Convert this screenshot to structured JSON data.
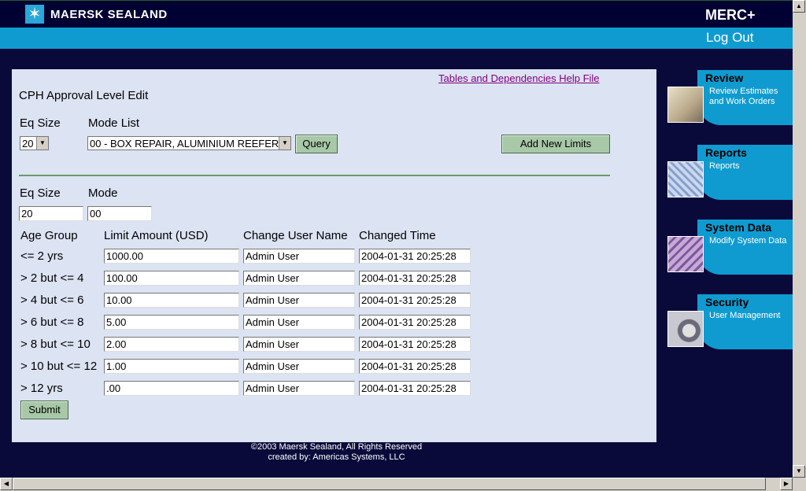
{
  "header": {
    "brand": "MAERSK SEALAND",
    "app": "MERC+",
    "logout": "Log Out"
  },
  "panel": {
    "help_link": "Tables and Dependencies Help File",
    "title": "CPH Approval Level Edit",
    "eq_size_label": "Eq Size",
    "mode_list_label": "Mode List",
    "eq_size_value": "20",
    "mode_list_value": "00 - BOX REPAIR, ALUMINIUM REEFER",
    "query_button": "Query",
    "add_button": "Add New Limits",
    "eq_size_label2": "Eq Size",
    "mode_label": "Mode",
    "eq_size_field": "20",
    "mode_field": "00",
    "columns": [
      "Age Group",
      "Limit Amount (USD)",
      "Change User Name",
      "Changed Time"
    ],
    "rows": [
      {
        "age": "<= 2 yrs",
        "limit": "1000.00",
        "user": "Admin User",
        "time": "2004-01-31 20:25:28"
      },
      {
        "age": "> 2 but <= 4",
        "limit": "100.00",
        "user": "Admin User",
        "time": "2004-01-31 20:25:28"
      },
      {
        "age": "> 4 but <= 6",
        "limit": "10.00",
        "user": "Admin User",
        "time": "2004-01-31 20:25:28"
      },
      {
        "age": "> 6 but <= 8",
        "limit": "5.00",
        "user": "Admin User",
        "time": "2004-01-31 20:25:28"
      },
      {
        "age": "> 8 but <= 10",
        "limit": "2.00",
        "user": "Admin User",
        "time": "2004-01-31 20:25:28"
      },
      {
        "age": "> 10 but <= 12",
        "limit": "1.00",
        "user": "Admin User",
        "time": "2004-01-31 20:25:28"
      },
      {
        "age": "> 12 yrs",
        "limit": ".00",
        "user": "Admin User",
        "time": "2004-01-31 20:25:28"
      }
    ],
    "submit": "Submit"
  },
  "footer": {
    "line1": "©2003 Maersk Sealand, All Rights Reserved",
    "line2": "created by: Americas Systems, LLC"
  },
  "sidenav": [
    {
      "heading": "Review",
      "links": [
        "Review Estimates",
        "and Work Orders"
      ],
      "icon": "documents-thumbnail"
    },
    {
      "heading": "Reports",
      "links": [
        "Reports"
      ],
      "icon": "reports-thumbnail"
    },
    {
      "heading": "System Data",
      "links": [
        "Modify System Data"
      ],
      "icon": "keyboard-thumbnail"
    },
    {
      "heading": "Security",
      "links": [
        "User Management"
      ],
      "icon": "lock-thumbnail"
    }
  ],
  "colors": {
    "navy": "#000033",
    "accent": "#0f9bd0",
    "panel": "#dce3f3",
    "button": "#a8c8a8"
  }
}
